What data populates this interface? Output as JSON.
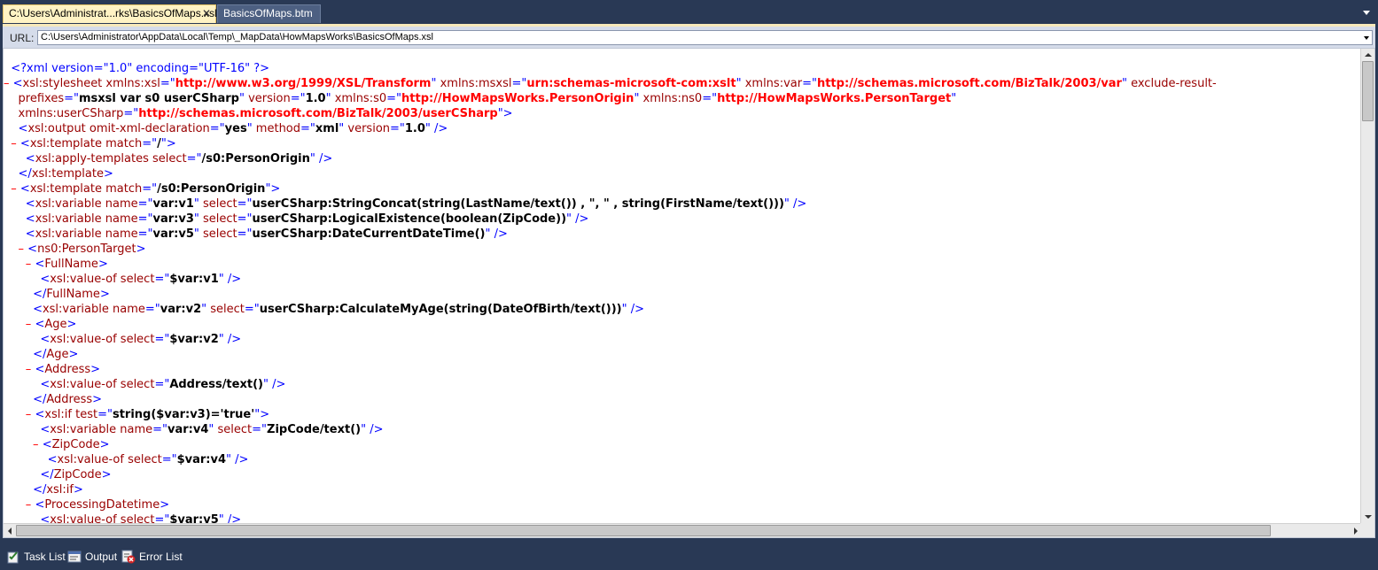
{
  "tabs": [
    {
      "label": "C:\\Users\\Administrat...rks\\BasicsOfMaps.xsl",
      "close": "✕"
    },
    {
      "label": "BasicsOfMaps.btm",
      "close": ""
    }
  ],
  "url": {
    "label": "URL:",
    "value": "C:\\Users\\Administrator\\AppData\\Local\\Temp\\_MapData\\HowMapsWorks\\BasicsOfMaps.xsl"
  },
  "code_lines": [
    [
      {
        "t": "  ",
        "c": ""
      },
      {
        "t": "<?xml version=\"1.0\" encoding=\"UTF-16\" ?>",
        "c": "pi"
      }
    ],
    [
      {
        "t": "– ",
        "c": "c"
      },
      {
        "t": "<",
        "c": "m"
      },
      {
        "t": "xsl:stylesheet",
        "c": "n"
      },
      {
        "t": " xmlns:xsl",
        "c": "a"
      },
      {
        "t": "=\"",
        "c": "m"
      },
      {
        "t": "http://www.w3.org/1999/XSL/Transform",
        "c": "u"
      },
      {
        "t": "\"",
        "c": "m"
      },
      {
        "t": " xmlns:msxsl",
        "c": "a"
      },
      {
        "t": "=\"",
        "c": "m"
      },
      {
        "t": "urn:schemas-microsoft-com:xslt",
        "c": "u"
      },
      {
        "t": "\"",
        "c": "m"
      },
      {
        "t": " xmlns:var",
        "c": "a"
      },
      {
        "t": "=\"",
        "c": "m"
      },
      {
        "t": "http://schemas.microsoft.com/BizTalk/2003/var",
        "c": "u"
      },
      {
        "t": "\"",
        "c": "m"
      },
      {
        "t": " exclude-result-",
        "c": "a"
      }
    ],
    [
      {
        "t": "    prefixes",
        "c": "a"
      },
      {
        "t": "=\"",
        "c": "m"
      },
      {
        "t": "msxsl var s0 userCSharp",
        "c": "v"
      },
      {
        "t": "\"",
        "c": "m"
      },
      {
        "t": " version",
        "c": "a"
      },
      {
        "t": "=\"",
        "c": "m"
      },
      {
        "t": "1.0",
        "c": "v"
      },
      {
        "t": "\"",
        "c": "m"
      },
      {
        "t": " xmlns:s0",
        "c": "a"
      },
      {
        "t": "=\"",
        "c": "m"
      },
      {
        "t": "http://HowMapsWorks.PersonOrigin",
        "c": "u"
      },
      {
        "t": "\"",
        "c": "m"
      },
      {
        "t": " xmlns:ns0",
        "c": "a"
      },
      {
        "t": "=\"",
        "c": "m"
      },
      {
        "t": "http://HowMapsWorks.PersonTarget",
        "c": "u"
      },
      {
        "t": "\"",
        "c": "m"
      }
    ],
    [
      {
        "t": "    xmlns:userCSharp",
        "c": "a"
      },
      {
        "t": "=\"",
        "c": "m"
      },
      {
        "t": "http://schemas.microsoft.com/BizTalk/2003/userCSharp",
        "c": "u"
      },
      {
        "t": "\">",
        "c": "m"
      }
    ],
    [
      {
        "t": "    ",
        "c": ""
      },
      {
        "t": "<",
        "c": "m"
      },
      {
        "t": "xsl:output",
        "c": "n"
      },
      {
        "t": " omit-xml-declaration",
        "c": "a"
      },
      {
        "t": "=\"",
        "c": "m"
      },
      {
        "t": "yes",
        "c": "v"
      },
      {
        "t": "\"",
        "c": "m"
      },
      {
        "t": " method",
        "c": "a"
      },
      {
        "t": "=\"",
        "c": "m"
      },
      {
        "t": "xml",
        "c": "v"
      },
      {
        "t": "\"",
        "c": "m"
      },
      {
        "t": " version",
        "c": "a"
      },
      {
        "t": "=\"",
        "c": "m"
      },
      {
        "t": "1.0",
        "c": "v"
      },
      {
        "t": "\" />",
        "c": "m"
      }
    ],
    [
      {
        "t": "  – ",
        "c": "c"
      },
      {
        "t": "<",
        "c": "m"
      },
      {
        "t": "xsl:template",
        "c": "n"
      },
      {
        "t": " match",
        "c": "a"
      },
      {
        "t": "=\"",
        "c": "m"
      },
      {
        "t": "/",
        "c": "v"
      },
      {
        "t": "\">",
        "c": "m"
      }
    ],
    [
      {
        "t": "      ",
        "c": ""
      },
      {
        "t": "<",
        "c": "m"
      },
      {
        "t": "xsl:apply-templates",
        "c": "n"
      },
      {
        "t": " select",
        "c": "a"
      },
      {
        "t": "=\"",
        "c": "m"
      },
      {
        "t": "/s0:PersonOrigin",
        "c": "v"
      },
      {
        "t": "\" />",
        "c": "m"
      }
    ],
    [
      {
        "t": "    ",
        "c": ""
      },
      {
        "t": "</",
        "c": "m"
      },
      {
        "t": "xsl:template",
        "c": "n"
      },
      {
        "t": ">",
        "c": "m"
      }
    ],
    [
      {
        "t": "  – ",
        "c": "c"
      },
      {
        "t": "<",
        "c": "m"
      },
      {
        "t": "xsl:template",
        "c": "n"
      },
      {
        "t": " match",
        "c": "a"
      },
      {
        "t": "=\"",
        "c": "m"
      },
      {
        "t": "/s0:PersonOrigin",
        "c": "v"
      },
      {
        "t": "\">",
        "c": "m"
      }
    ],
    [
      {
        "t": "      ",
        "c": ""
      },
      {
        "t": "<",
        "c": "m"
      },
      {
        "t": "xsl:variable",
        "c": "n"
      },
      {
        "t": " name",
        "c": "a"
      },
      {
        "t": "=\"",
        "c": "m"
      },
      {
        "t": "var:v1",
        "c": "v"
      },
      {
        "t": "\"",
        "c": "m"
      },
      {
        "t": " select",
        "c": "a"
      },
      {
        "t": "=\"",
        "c": "m"
      },
      {
        "t": "userCSharp:StringConcat(string(LastName/text()) , \", \" , string(FirstName/text()))",
        "c": "v"
      },
      {
        "t": "\" />",
        "c": "m"
      }
    ],
    [
      {
        "t": "      ",
        "c": ""
      },
      {
        "t": "<",
        "c": "m"
      },
      {
        "t": "xsl:variable",
        "c": "n"
      },
      {
        "t": " name",
        "c": "a"
      },
      {
        "t": "=\"",
        "c": "m"
      },
      {
        "t": "var:v3",
        "c": "v"
      },
      {
        "t": "\"",
        "c": "m"
      },
      {
        "t": " select",
        "c": "a"
      },
      {
        "t": "=\"",
        "c": "m"
      },
      {
        "t": "userCSharp:LogicalExistence(boolean(ZipCode))",
        "c": "v"
      },
      {
        "t": "\" />",
        "c": "m"
      }
    ],
    [
      {
        "t": "      ",
        "c": ""
      },
      {
        "t": "<",
        "c": "m"
      },
      {
        "t": "xsl:variable",
        "c": "n"
      },
      {
        "t": " name",
        "c": "a"
      },
      {
        "t": "=\"",
        "c": "m"
      },
      {
        "t": "var:v5",
        "c": "v"
      },
      {
        "t": "\"",
        "c": "m"
      },
      {
        "t": " select",
        "c": "a"
      },
      {
        "t": "=\"",
        "c": "m"
      },
      {
        "t": "userCSharp:DateCurrentDateTime()",
        "c": "v"
      },
      {
        "t": "\" />",
        "c": "m"
      }
    ],
    [
      {
        "t": "    – ",
        "c": "c"
      },
      {
        "t": "<",
        "c": "m"
      },
      {
        "t": "ns0:PersonTarget",
        "c": "n"
      },
      {
        "t": ">",
        "c": "m"
      }
    ],
    [
      {
        "t": "      – ",
        "c": "c"
      },
      {
        "t": "<",
        "c": "m"
      },
      {
        "t": "FullName",
        "c": "n"
      },
      {
        "t": ">",
        "c": "m"
      }
    ],
    [
      {
        "t": "          ",
        "c": ""
      },
      {
        "t": "<",
        "c": "m"
      },
      {
        "t": "xsl:value-of",
        "c": "n"
      },
      {
        "t": " select",
        "c": "a"
      },
      {
        "t": "=\"",
        "c": "m"
      },
      {
        "t": "$var:v1",
        "c": "v"
      },
      {
        "t": "\" />",
        "c": "m"
      }
    ],
    [
      {
        "t": "        ",
        "c": ""
      },
      {
        "t": "</",
        "c": "m"
      },
      {
        "t": "FullName",
        "c": "n"
      },
      {
        "t": ">",
        "c": "m"
      }
    ],
    [
      {
        "t": "        ",
        "c": ""
      },
      {
        "t": "<",
        "c": "m"
      },
      {
        "t": "xsl:variable",
        "c": "n"
      },
      {
        "t": " name",
        "c": "a"
      },
      {
        "t": "=\"",
        "c": "m"
      },
      {
        "t": "var:v2",
        "c": "v"
      },
      {
        "t": "\"",
        "c": "m"
      },
      {
        "t": " select",
        "c": "a"
      },
      {
        "t": "=\"",
        "c": "m"
      },
      {
        "t": "userCSharp:CalculateMyAge(string(DateOfBirth/text()))",
        "c": "v"
      },
      {
        "t": "\" />",
        "c": "m"
      }
    ],
    [
      {
        "t": "      – ",
        "c": "c"
      },
      {
        "t": "<",
        "c": "m"
      },
      {
        "t": "Age",
        "c": "n"
      },
      {
        "t": ">",
        "c": "m"
      }
    ],
    [
      {
        "t": "          ",
        "c": ""
      },
      {
        "t": "<",
        "c": "m"
      },
      {
        "t": "xsl:value-of",
        "c": "n"
      },
      {
        "t": " select",
        "c": "a"
      },
      {
        "t": "=\"",
        "c": "m"
      },
      {
        "t": "$var:v2",
        "c": "v"
      },
      {
        "t": "\" />",
        "c": "m"
      }
    ],
    [
      {
        "t": "        ",
        "c": ""
      },
      {
        "t": "</",
        "c": "m"
      },
      {
        "t": "Age",
        "c": "n"
      },
      {
        "t": ">",
        "c": "m"
      }
    ],
    [
      {
        "t": "      – ",
        "c": "c"
      },
      {
        "t": "<",
        "c": "m"
      },
      {
        "t": "Address",
        "c": "n"
      },
      {
        "t": ">",
        "c": "m"
      }
    ],
    [
      {
        "t": "          ",
        "c": ""
      },
      {
        "t": "<",
        "c": "m"
      },
      {
        "t": "xsl:value-of",
        "c": "n"
      },
      {
        "t": " select",
        "c": "a"
      },
      {
        "t": "=\"",
        "c": "m"
      },
      {
        "t": "Address/text()",
        "c": "v"
      },
      {
        "t": "\" />",
        "c": "m"
      }
    ],
    [
      {
        "t": "        ",
        "c": ""
      },
      {
        "t": "</",
        "c": "m"
      },
      {
        "t": "Address",
        "c": "n"
      },
      {
        "t": ">",
        "c": "m"
      }
    ],
    [
      {
        "t": "      – ",
        "c": "c"
      },
      {
        "t": "<",
        "c": "m"
      },
      {
        "t": "xsl:if",
        "c": "n"
      },
      {
        "t": " test",
        "c": "a"
      },
      {
        "t": "=\"",
        "c": "m"
      },
      {
        "t": "string($var:v3)='true'",
        "c": "v"
      },
      {
        "t": "\">",
        "c": "m"
      }
    ],
    [
      {
        "t": "          ",
        "c": ""
      },
      {
        "t": "<",
        "c": "m"
      },
      {
        "t": "xsl:variable",
        "c": "n"
      },
      {
        "t": " name",
        "c": "a"
      },
      {
        "t": "=\"",
        "c": "m"
      },
      {
        "t": "var:v4",
        "c": "v"
      },
      {
        "t": "\"",
        "c": "m"
      },
      {
        "t": " select",
        "c": "a"
      },
      {
        "t": "=\"",
        "c": "m"
      },
      {
        "t": "ZipCode/text()",
        "c": "v"
      },
      {
        "t": "\" />",
        "c": "m"
      }
    ],
    [
      {
        "t": "        – ",
        "c": "c"
      },
      {
        "t": "<",
        "c": "m"
      },
      {
        "t": "ZipCode",
        "c": "n"
      },
      {
        "t": ">",
        "c": "m"
      }
    ],
    [
      {
        "t": "            ",
        "c": ""
      },
      {
        "t": "<",
        "c": "m"
      },
      {
        "t": "xsl:value-of",
        "c": "n"
      },
      {
        "t": " select",
        "c": "a"
      },
      {
        "t": "=\"",
        "c": "m"
      },
      {
        "t": "$var:v4",
        "c": "v"
      },
      {
        "t": "\" />",
        "c": "m"
      }
    ],
    [
      {
        "t": "          ",
        "c": ""
      },
      {
        "t": "</",
        "c": "m"
      },
      {
        "t": "ZipCode",
        "c": "n"
      },
      {
        "t": ">",
        "c": "m"
      }
    ],
    [
      {
        "t": "        ",
        "c": ""
      },
      {
        "t": "</",
        "c": "m"
      },
      {
        "t": "xsl:if",
        "c": "n"
      },
      {
        "t": ">",
        "c": "m"
      }
    ],
    [
      {
        "t": "      – ",
        "c": "c"
      },
      {
        "t": "<",
        "c": "m"
      },
      {
        "t": "ProcessingDatetime",
        "c": "n"
      },
      {
        "t": ">",
        "c": "m"
      }
    ],
    [
      {
        "t": "          ",
        "c": ""
      },
      {
        "t": "<",
        "c": "m"
      },
      {
        "t": "xsl:value-of",
        "c": "n"
      },
      {
        "t": " select",
        "c": "a"
      },
      {
        "t": "=\"",
        "c": "m"
      },
      {
        "t": "$var:v5",
        "c": "v"
      },
      {
        "t": "\" />",
        "c": "m"
      }
    ]
  ],
  "bottom_tabs": [
    {
      "label": "Task List",
      "icon": "task-list-icon"
    },
    {
      "label": "Output",
      "icon": "output-icon"
    },
    {
      "label": "Error List",
      "icon": "error-list-icon"
    }
  ],
  "colors": {
    "chrome": "#293955",
    "markup": "#0000ff",
    "element_name": "#990000",
    "namespace_uri": "#ff0000",
    "value": "#000000"
  }
}
